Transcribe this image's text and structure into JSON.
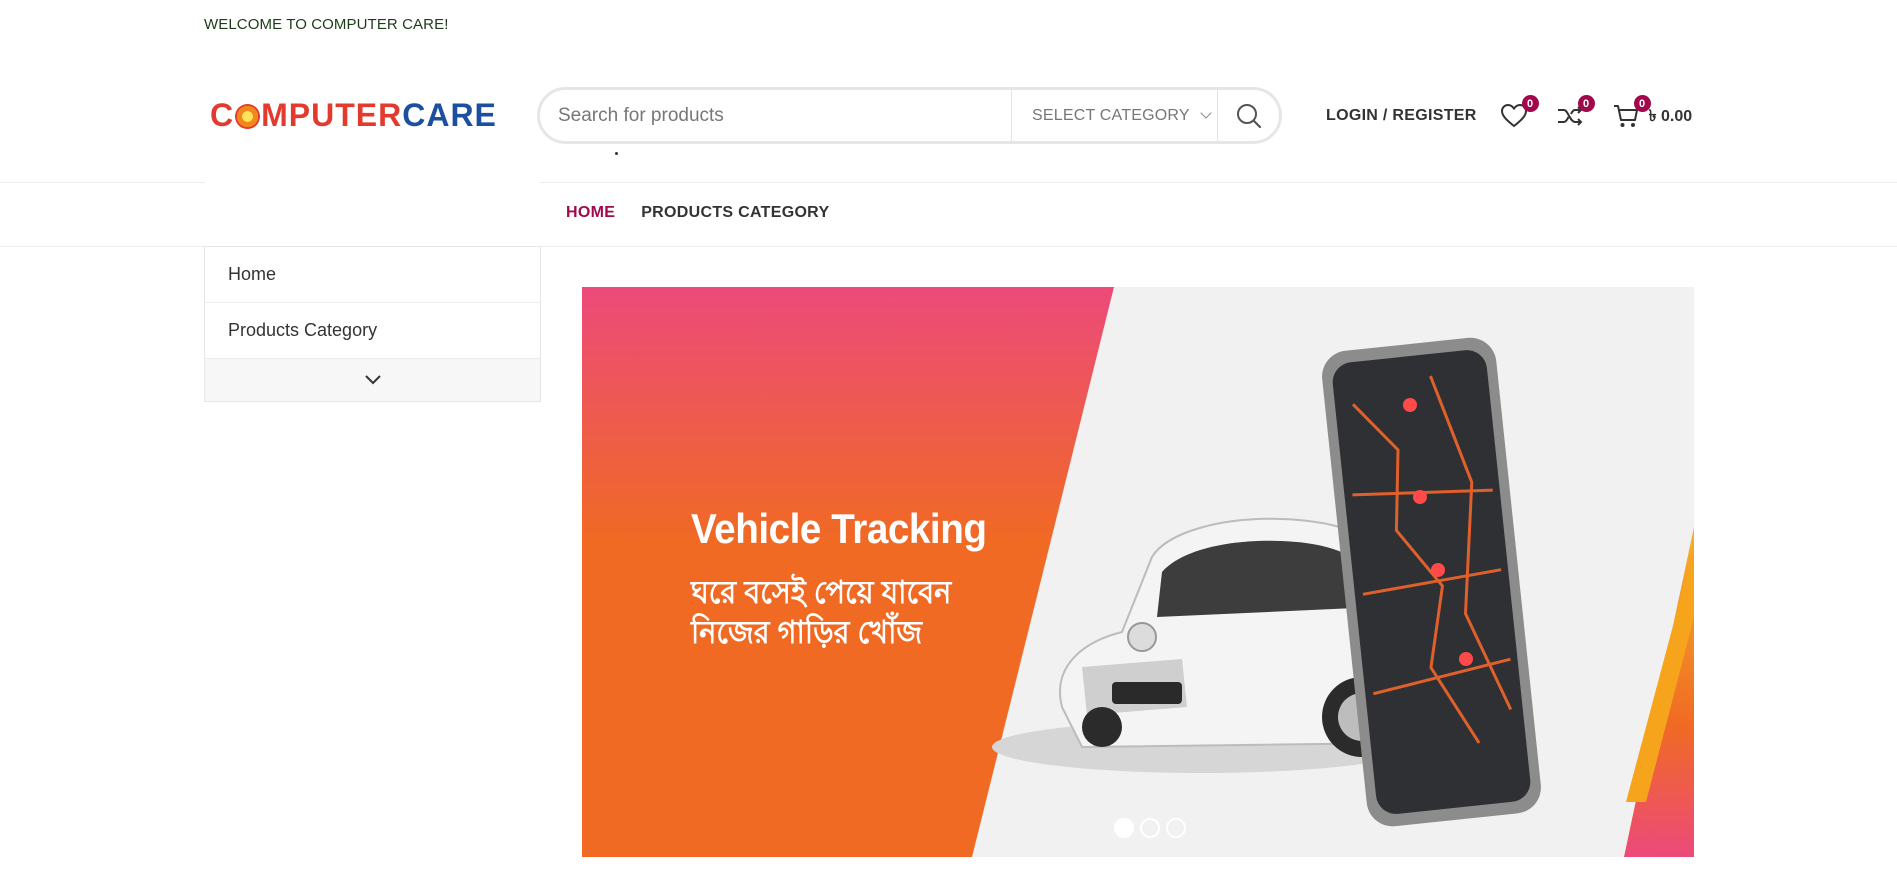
{
  "topbar": {
    "welcome_text": "WELCOME TO COMPUTER CARE!"
  },
  "logo": {
    "part1": "C",
    "part1b": "MPUTER",
    "part2": "CARE"
  },
  "search": {
    "placeholder": "Search for products",
    "category_label": "SELECT CATEGORY"
  },
  "header": {
    "login_label": "LOGIN / REGISTER",
    "wishlist_count": "0",
    "compare_count": "0",
    "cart_count": "0",
    "cart_total": "৳ 0.00"
  },
  "nav": {
    "items": [
      {
        "label": "HOME"
      },
      {
        "label": "PRODUCTS CATEGORY"
      }
    ]
  },
  "sidebar": {
    "items": [
      {
        "label": "Home"
      },
      {
        "label": "Products Category"
      }
    ]
  },
  "banner": {
    "title": "Vehicle Tracking",
    "line1": "ঘরে বসেই পেয়ে যাবেন",
    "line2": "নিজের গাড়ির খোঁজ",
    "slides": 3,
    "active_slide": 1
  },
  "colors": {
    "accent": "#a0094c",
    "banner_pink": "#ec4a7a",
    "banner_orange": "#f06a23",
    "logo_red": "#e23a2e",
    "logo_blue": "#1d4fa0"
  }
}
